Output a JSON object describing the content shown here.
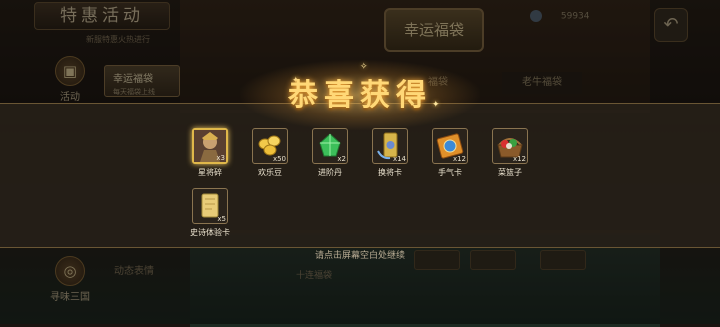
{
  "header": {
    "title": "特惠活动",
    "subtitle": "新服特惠火热进行",
    "shop_sign": "幸运福袋",
    "coins": "59934"
  },
  "sidebar": {
    "items": [
      {
        "label": "活动",
        "icon": "gift-icon"
      },
      {
        "label": "寻味三国",
        "icon": "dragon-icon"
      }
    ]
  },
  "tabs": {
    "lucky_bag": {
      "label": "幸运福袋",
      "sub": "每天福袋上线"
    },
    "middle": "福袋",
    "old": "老牛福袋",
    "dynamic": "动态表情"
  },
  "bottom_banner": "十连福袋",
  "modal": {
    "title": "恭喜获得",
    "hint": "请点击屏幕空白处继续",
    "items": [
      {
        "name": "星将碎",
        "qty": "x3",
        "icon": "general-portrait-icon",
        "highlight": true
      },
      {
        "name": "欢乐豆",
        "qty": "x50",
        "icon": "gold-beans-icon",
        "highlight": false
      },
      {
        "name": "进阶丹",
        "qty": "x2",
        "icon": "jade-pill-icon",
        "highlight": false
      },
      {
        "name": "换将卡",
        "qty": "x14",
        "icon": "exchange-card-icon",
        "highlight": false
      },
      {
        "name": "手气卡",
        "qty": "x12",
        "icon": "luck-card-icon",
        "highlight": false
      },
      {
        "name": "菜篮子",
        "qty": "x12",
        "icon": "vegetable-basket-icon",
        "highlight": false
      },
      {
        "name": "史诗体验卡",
        "qty": "x5",
        "icon": "epic-trial-card-icon",
        "highlight": false
      }
    ]
  },
  "colors": {
    "title_gold": "#ffd877",
    "panel_bg": "#261f18",
    "highlight_border": "#e0b84a"
  }
}
